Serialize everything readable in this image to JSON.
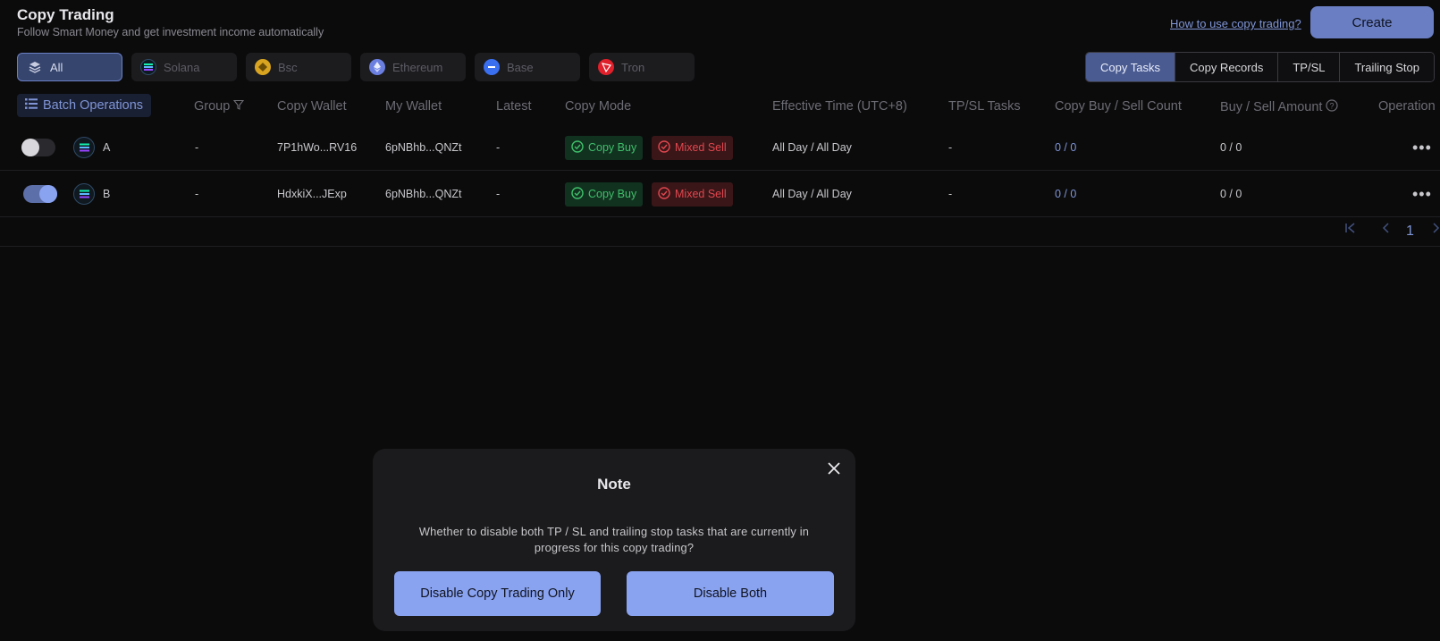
{
  "header": {
    "title": "Copy Trading",
    "subtitle": "Follow Smart Money and get investment income automatically",
    "help_link": "How to use copy trading?",
    "create_label": "Create"
  },
  "chains": [
    {
      "label": "All",
      "icon": "layers-icon",
      "active": true
    },
    {
      "label": "Solana",
      "icon": "solana-icon",
      "color": "#14f1b0"
    },
    {
      "label": "Bsc",
      "icon": "bsc-icon",
      "color": "#d9a520"
    },
    {
      "label": "Ethereum",
      "icon": "ethereum-icon",
      "color": "#6a7fe0"
    },
    {
      "label": "Base",
      "icon": "base-icon",
      "color": "#3a6ff0"
    },
    {
      "label": "Tron",
      "icon": "tron-icon",
      "color": "#e0202a"
    }
  ],
  "view_tabs": [
    {
      "label": "Copy Tasks",
      "active": true
    },
    {
      "label": "Copy Records"
    },
    {
      "label": "TP/SL"
    },
    {
      "label": "Trailing Stop"
    }
  ],
  "toolbar": {
    "batch_label": "Batch Operations"
  },
  "columns": {
    "group": "Group",
    "copy_wallet": "Copy Wallet",
    "my_wallet": "My Wallet",
    "latest": "Latest",
    "copy_mode": "Copy Mode",
    "effective_time": "Effective Time (UTC+8)",
    "tpsl_tasks": "TP/SL Tasks",
    "count": "Copy Buy / Sell Count",
    "amount": "Buy / Sell Amount",
    "operation": "Operation"
  },
  "rows": [
    {
      "enabled": false,
      "name": "A",
      "group": "-",
      "copy_wallet": "7P1hWo...RV16",
      "my_wallet": "6pNBhb...QNZt",
      "latest": "-",
      "buy_mode": "Copy Buy",
      "sell_mode": "Mixed Sell",
      "effective_time": "All Day / All Day",
      "tpsl_tasks": "-",
      "count": "0 / 0",
      "amount": "0 / 0"
    },
    {
      "enabled": true,
      "name": "B",
      "group": "-",
      "copy_wallet": "HdxkiX...JExp",
      "my_wallet": "6pNBhb...QNZt",
      "latest": "-",
      "buy_mode": "Copy Buy",
      "sell_mode": "Mixed Sell",
      "effective_time": "All Day / All Day",
      "tpsl_tasks": "-",
      "count": "0 / 0",
      "amount": "0 / 0"
    }
  ],
  "pagination": {
    "current_page": "1"
  },
  "modal": {
    "title": "Note",
    "message": "Whether to disable both TP / SL and trailing stop tasks that are currently in progress for this copy trading?",
    "btn_only": "Disable Copy Trading Only",
    "btn_both": "Disable Both"
  }
}
